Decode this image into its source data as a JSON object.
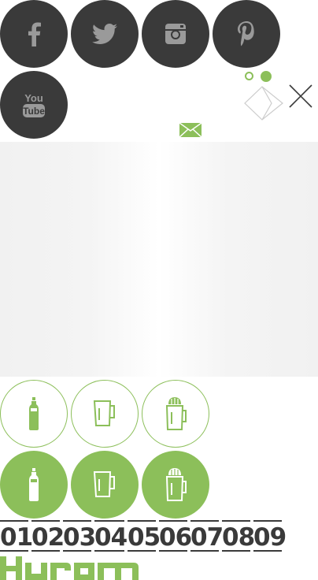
{
  "social": [
    {
      "name": "facebook",
      "icon": "facebook-icon"
    },
    {
      "name": "twitter",
      "icon": "twitter-icon"
    },
    {
      "name": "instagram",
      "icon": "instagram-icon"
    },
    {
      "name": "pinterest",
      "icon": "pinterest-icon"
    },
    {
      "name": "youtube",
      "icon": "youtube-icon",
      "line1": "You",
      "line2": "Tube"
    }
  ],
  "colors": {
    "accent": "#8cbf5a",
    "dark": "#3a3a3a"
  },
  "pager": {
    "active_index": 1,
    "count": 2
  },
  "numbers": [
    "01",
    "02",
    "03",
    "04",
    "05",
    "06",
    "07",
    "08",
    "09"
  ],
  "brand": {
    "logo_text": "HUROM"
  }
}
